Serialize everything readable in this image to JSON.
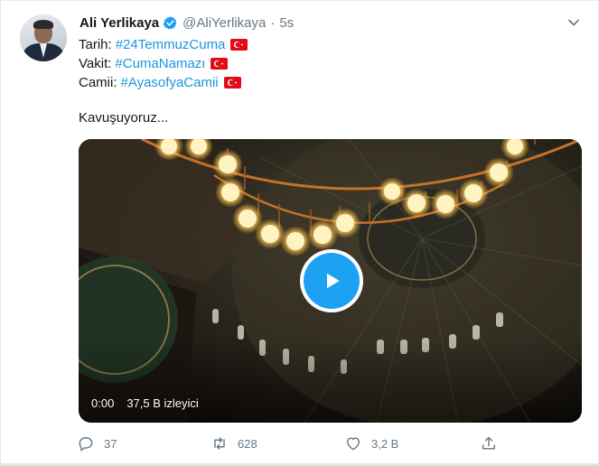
{
  "tweet": {
    "author_name": "Ali Yerlikaya",
    "handle": "@AliYerlikaya",
    "separator": "·",
    "time": "5s",
    "lines": [
      {
        "label": "Tarih:",
        "hashtag": "#24TemmuzCuma"
      },
      {
        "label": "Vakit:",
        "hashtag": "#CumaNamazı"
      },
      {
        "label": "Camii:",
        "hashtag": "#AyasofyaCamii"
      }
    ],
    "message": "Kavuşuyoruz..."
  },
  "video": {
    "duration": "0:00",
    "views": "37,5 B izleyici"
  },
  "actions": {
    "reply_count": "37",
    "retweet_count": "628",
    "like_count": "3,2 B"
  },
  "icons": {
    "verified": "verified-badge-icon",
    "more": "chevron-down-icon",
    "flag": "turkey-flag-icon",
    "play": "play-icon",
    "reply": "reply-icon",
    "retweet": "retweet-icon",
    "like": "heart-icon",
    "share": "share-icon"
  },
  "colors": {
    "accent": "#1da1f2",
    "hashtag": "#1b95e0",
    "secondary_text": "#657786",
    "flag_red": "#e30a17"
  }
}
